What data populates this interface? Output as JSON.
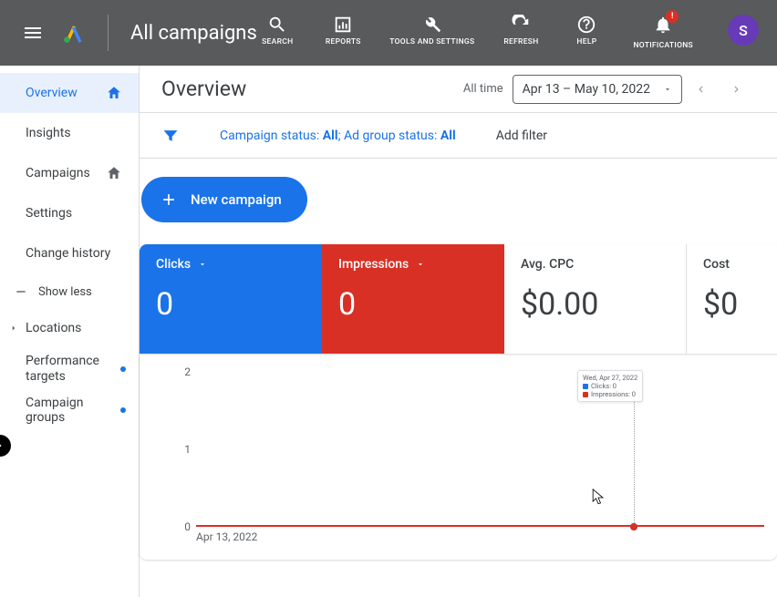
{
  "topbar": {
    "scope_title": "All campaigns",
    "tools": {
      "search": "SEARCH",
      "reports": "REPORTS",
      "tools": "TOOLS AND SETTINGS",
      "refresh": "REFRESH",
      "help": "HELP",
      "notifications": "NOTIFICATIONS"
    },
    "notification_badge": "!",
    "avatar_letter": "S"
  },
  "sidebar": {
    "items": {
      "overview": "Overview",
      "insights": "Insights",
      "campaigns": "Campaigns",
      "settings": "Settings",
      "change_history": "Change history"
    },
    "show_less": "Show less",
    "sub": {
      "locations": "Locations",
      "performance_targets": "Performance targets",
      "campaign_groups": "Campaign groups"
    }
  },
  "page": {
    "title": "Overview",
    "date_range_label": "All time",
    "date_range_value": "Apr 13 – May 10, 2022"
  },
  "filter": {
    "part1": "Campaign status: ",
    "val1": "All",
    "sep": "; ",
    "part2": "Ad group status: ",
    "val2": "All",
    "add": "Add filter"
  },
  "buttons": {
    "new_campaign": "New campaign"
  },
  "cards": {
    "clicks": {
      "label": "Clicks",
      "value": "0"
    },
    "impressions": {
      "label": "Impressions",
      "value": "0"
    },
    "avg_cpc": {
      "label": "Avg. CPC",
      "value": "$0.00"
    },
    "cost": {
      "label": "Cost",
      "value": "$0"
    }
  },
  "chart_data": {
    "type": "line",
    "x_start_label": "Apr 13, 2022",
    "ylim": [
      0,
      2
    ],
    "y_ticks": [
      "0",
      "1",
      "2"
    ],
    "series": [
      {
        "name": "Clicks",
        "color": "#1a73e8",
        "flat_value": 0
      },
      {
        "name": "Impressions",
        "color": "#d93025",
        "flat_value": 0
      }
    ],
    "tooltip": {
      "date": "Wed, Apr 27, 2022",
      "row1": "Clicks: 0",
      "row2": "Impressions: 0"
    }
  }
}
